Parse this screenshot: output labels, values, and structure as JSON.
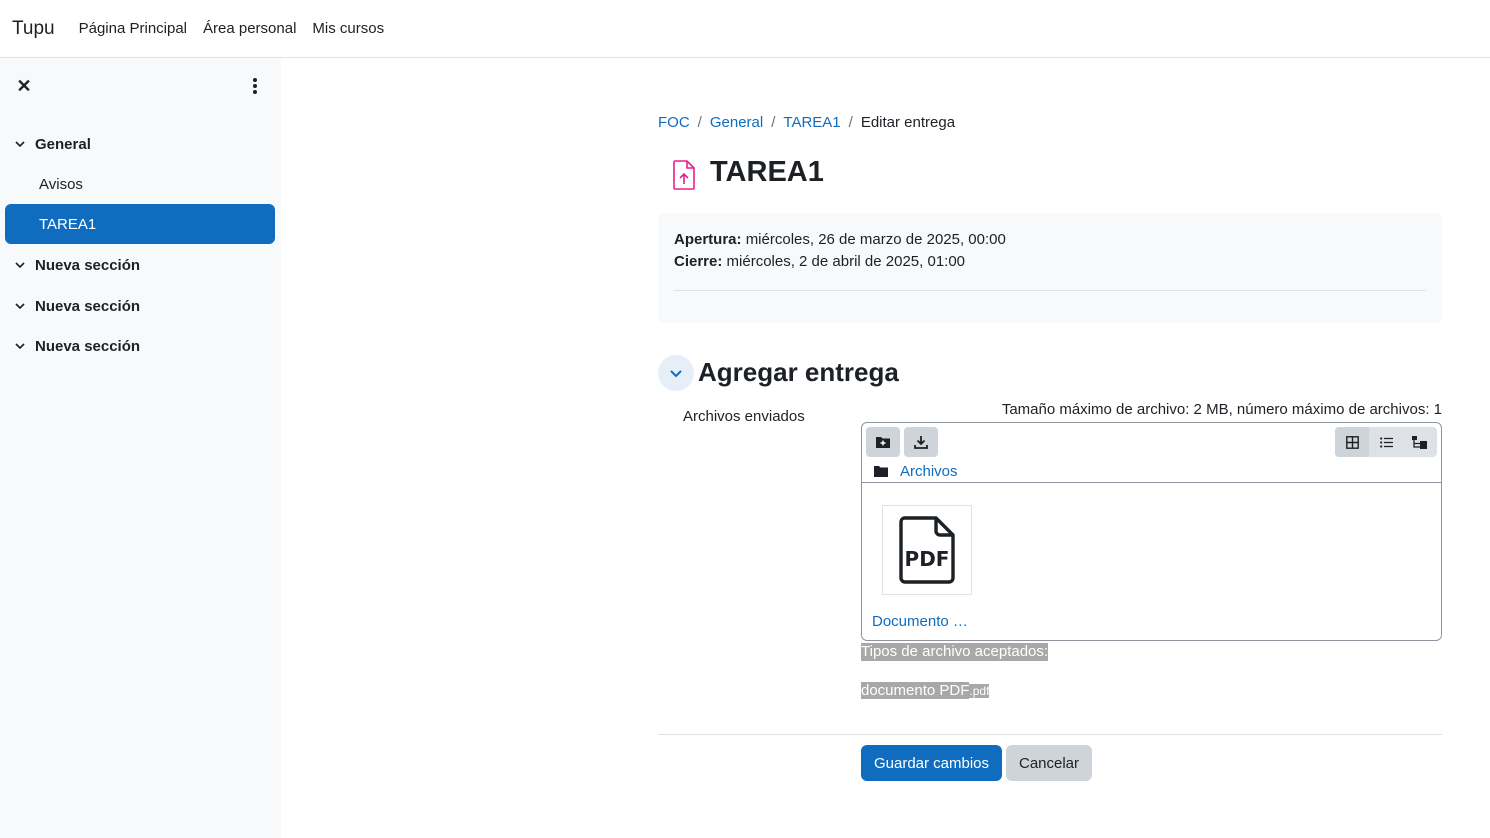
{
  "navbar": {
    "brand": "Tupu",
    "links": [
      "Página Principal",
      "Área personal",
      "Mis cursos"
    ]
  },
  "drawer": {
    "close_icon": "close-icon",
    "menu_icon": "kebab-icon",
    "sections": [
      {
        "label": "General",
        "items": [
          "Avisos",
          "TAREA1"
        ]
      },
      {
        "label": "Nueva sección"
      },
      {
        "label": "Nueva sección"
      },
      {
        "label": "Nueva sección"
      }
    ],
    "active_item": "TAREA1"
  },
  "breadcrumb": [
    "FOC",
    "General",
    "TAREA1",
    "Editar entrega"
  ],
  "page": {
    "title": "TAREA1",
    "icon": "assignment-upload-icon",
    "icon_color": "#e91e8c"
  },
  "dates": {
    "open_label": "Apertura:",
    "open_value": "miércoles, 26 de marzo de 2025, 00:00",
    "close_label": "Cierre:",
    "close_value": "miércoles, 2 de abril de 2025, 01:00"
  },
  "submission": {
    "section_title": "Agregar entrega",
    "field_label": "Archivos enviados",
    "max_size_text": "Tamaño máximo de archivo: 2 MB, número máximo de archivos: 1",
    "path_label": "Archivos",
    "files": [
      {
        "name": "Documento …",
        "type": "PDF"
      }
    ],
    "accepted_title": "Tipos de archivo aceptados:",
    "accepted_type": "documento PDF",
    "accepted_ext": ".pdf"
  },
  "actions": {
    "save": "Guardar cambios",
    "cancel": "Cancelar"
  },
  "colors": {
    "primary": "#0f6cbf",
    "drawer_bg": "#f8f9fa",
    "secondary_btn": "#ced4da"
  }
}
